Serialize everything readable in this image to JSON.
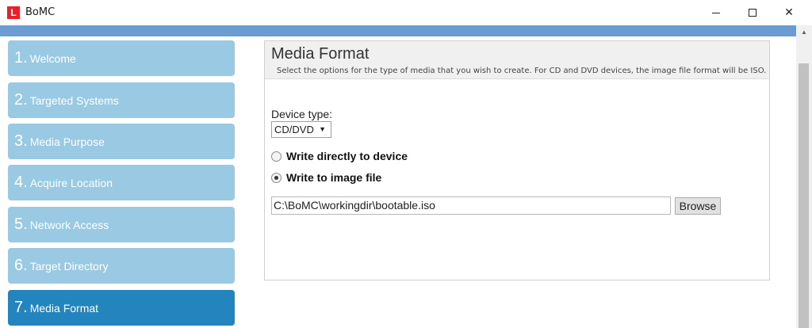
{
  "window": {
    "logo": "L",
    "title": "BoMC",
    "minimize_glyph": "",
    "maximize_glyph": "",
    "close_glyph": "✕"
  },
  "steps": [
    {
      "num": "1.",
      "label": "Welcome",
      "active": false
    },
    {
      "num": "2.",
      "label": "Targeted Systems",
      "active": false
    },
    {
      "num": "3.",
      "label": "Media Purpose",
      "active": false
    },
    {
      "num": "4.",
      "label": "Acquire Location",
      "active": false
    },
    {
      "num": "5.",
      "label": "Network Access",
      "active": false
    },
    {
      "num": "6.",
      "label": "Target Directory",
      "active": false
    },
    {
      "num": "7.",
      "label": "Media Format",
      "active": true
    }
  ],
  "panel": {
    "title": "Media Format",
    "description": "Select the options for the type of media that you wish to create. For CD and DVD devices, the image file format will be ISO.",
    "device_type_label": "Device type:",
    "device_type_value": "CD/DVD",
    "radio_direct": {
      "label": "Write directly to device",
      "checked": false
    },
    "radio_image": {
      "label": "Write to image file",
      "checked": true
    },
    "path_value": "C:\\BoMC\\workingdir\\bootable.iso",
    "browse_label": "Browse"
  },
  "colors": {
    "banner": "#6a9bd1",
    "step_inactive": "#99c9e3",
    "step_active": "#2384be",
    "logo": "#e8202a"
  },
  "icons": {
    "logo": "app-logo-icon",
    "minimize": "minimize-icon",
    "maximize": "maximize-icon",
    "close": "close-icon",
    "dropdown": "chevron-down-icon",
    "scroll_up": "scroll-up-arrow-icon"
  }
}
